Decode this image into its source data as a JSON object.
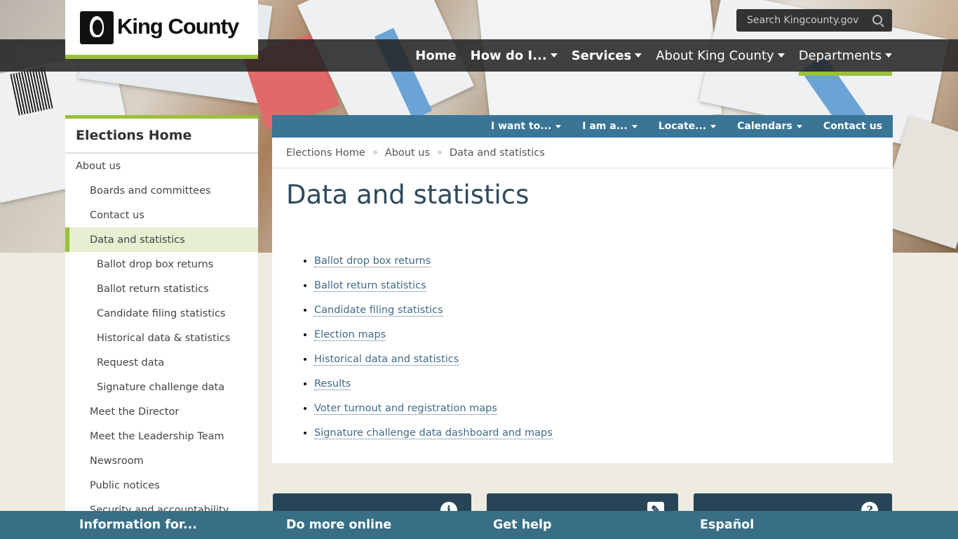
{
  "header": {
    "logo_text": "King County",
    "search_placeholder": "Search Kingcounty.gov",
    "nav": [
      {
        "label": "Home"
      },
      {
        "label": "How do I..."
      },
      {
        "label": "Services"
      },
      {
        "label": "About King County"
      },
      {
        "label": "Departments"
      }
    ]
  },
  "subnav": [
    {
      "label": "I want to..."
    },
    {
      "label": "I am a..."
    },
    {
      "label": "Locate..."
    },
    {
      "label": "Calendars"
    },
    {
      "label": "Contact us"
    }
  ],
  "sidebar": {
    "title": "Elections Home",
    "items": [
      {
        "label": "About us"
      },
      {
        "label": "Boards and committees"
      },
      {
        "label": "Contact us"
      },
      {
        "label": "Data and statistics"
      },
      {
        "label": "Ballot drop box returns"
      },
      {
        "label": "Ballot return statistics"
      },
      {
        "label": "Candidate filing statistics"
      },
      {
        "label": "Historical data & statistics"
      },
      {
        "label": "Request data"
      },
      {
        "label": "Signature challenge data"
      },
      {
        "label": "Meet the Director"
      },
      {
        "label": "Meet the Leadership Team"
      },
      {
        "label": "Newsroom"
      },
      {
        "label": "Public notices"
      },
      {
        "label": "Security and accountability"
      }
    ]
  },
  "breadcrumb": [
    "Elections Home",
    "About us",
    "Data and statistics"
  ],
  "main": {
    "title": "Data and statistics",
    "links": [
      "Ballot drop box returns",
      "Ballot return statistics",
      "Candidate filing statistics",
      "Election maps",
      "Historical data and statistics",
      "Results",
      "Voter turnout and registration maps",
      "Signature challenge data dashboard and maps"
    ]
  },
  "footer": {
    "columns": [
      "Information for...",
      "Do more online",
      "Get help",
      "Español"
    ]
  },
  "colors": {
    "accent_green": "#9ac03b",
    "nav_dark": "#222222",
    "subnav_blue": "#3a7596",
    "footer_blue": "#386f86",
    "title_text": "#2e4a5c"
  }
}
